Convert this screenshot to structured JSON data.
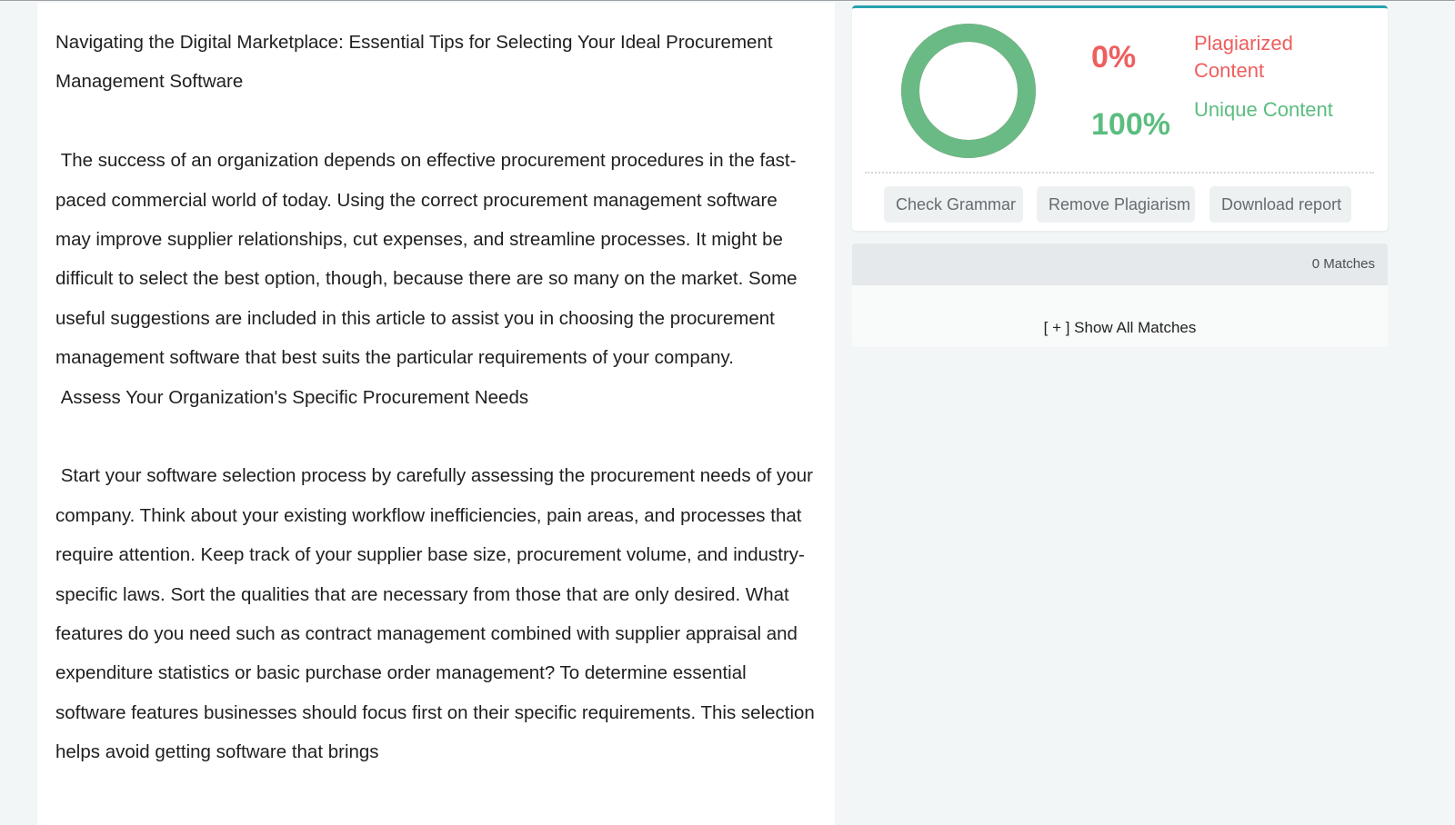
{
  "document": {
    "paragraphs": [
      "Navigating the Digital Marketplace: Essential Tips for Selecting Your Ideal Procurement Management Software",
      "",
      " The success of an organization depends on effective procurement procedures in the fast-paced commercial world of today. Using the correct procurement management software may improve supplier relationships, cut expenses, and streamline processes. It might be difficult to select the best option, though, because there are so many on the market. Some useful suggestions are included in this article to assist you in choosing the procurement management software that best suits the particular requirements of your company.",
      " Assess Your Organization's Specific Procurement Needs",
      "",
      " Start your software selection process by carefully assessing the procurement needs of your company. Think about your existing workflow inefficiencies, pain areas, and processes that require attention. Keep track of your supplier base size, procurement volume, and industry-specific laws. Sort the qualities that are necessary from those that are only desired. What features do you need such as contract management combined with supplier appraisal and expenditure statistics or basic purchase order management? To determine essential software features businesses should focus first on their specific requirements. This selection helps avoid getting software that brings"
    ]
  },
  "result": {
    "plagiarized_percent": "0%",
    "plagiarized_label": "Plagiarized Content",
    "unique_percent": "100%",
    "unique_label": "Unique Content",
    "unique_fraction": 1.0,
    "colors": {
      "plagiarized": "#ee5e5e",
      "unique": "#5bbd7f",
      "accent": "#27a3ae"
    }
  },
  "actions": {
    "check_grammar": "Check Grammar",
    "remove_plagiarism": "Remove Plagiarism",
    "download_report": "Download report"
  },
  "matches": {
    "count_label": "0 Matches",
    "show_all_label": "[ + ] Show All Matches"
  }
}
